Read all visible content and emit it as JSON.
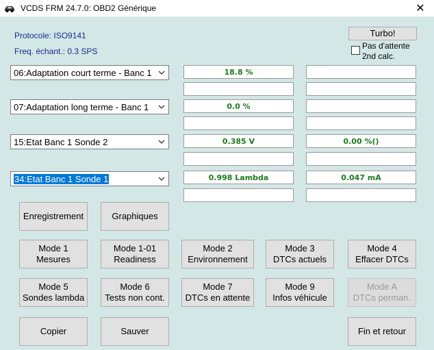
{
  "window": {
    "title": "VCDS FRM 24.7.0:  OBD2 Générique",
    "close_glyph": "✕"
  },
  "info": {
    "protocol": "Protocole: ISO9141",
    "freq": "Freq. échant.: 0.3 SPS"
  },
  "turbo": {
    "label": "Turbo!",
    "wait_line1": "Pas d'attente",
    "wait_line2": "2nd calc."
  },
  "groups": [
    {
      "select": "06:Adaptation court terme - Banc 1",
      "v1": "18.8 %",
      "v2": "",
      "v3": "",
      "v4": ""
    },
    {
      "select": "07:Adaptation long terme - Banc 1",
      "v1": "0.0 %",
      "v2": "",
      "v3": "",
      "v4": ""
    },
    {
      "select": "15:Etat Banc 1 Sonde 2",
      "v1": "0.385 V",
      "v2": "0.00 %()",
      "v3": "",
      "v4": ""
    },
    {
      "select": "34:Etat Banc 1 Sonde 1",
      "v1": "0.998 Lambda",
      "v2": "0.047 mA",
      "v3": "",
      "v4": ""
    }
  ],
  "buttons": {
    "record": "Enregistrement",
    "graphs": "Graphiques",
    "mode1_a": "Mode 1",
    "mode1_b": "Mesures",
    "mode101_a": "Mode 1-01",
    "mode101_b": "Readiness",
    "mode2_a": "Mode 2",
    "mode2_b": "Environnement",
    "mode3_a": "Mode 3",
    "mode3_b": "DTCs actuels",
    "mode4_a": "Mode 4",
    "mode4_b": "Effacer DTCs",
    "mode5_a": "Mode 5",
    "mode5_b": "Sondes lambda",
    "mode6_a": "Mode 6",
    "mode6_b": "Tests non cont.",
    "mode7_a": "Mode 7",
    "mode7_b": "DTCs en attente",
    "mode9_a": "Mode 9",
    "mode9_b": "Infos véhicule",
    "modeA_a": "Mode A",
    "modeA_b": "DTCs perman.",
    "copy": "Copier",
    "save": "Sauver",
    "finish": "Fin et retour"
  }
}
